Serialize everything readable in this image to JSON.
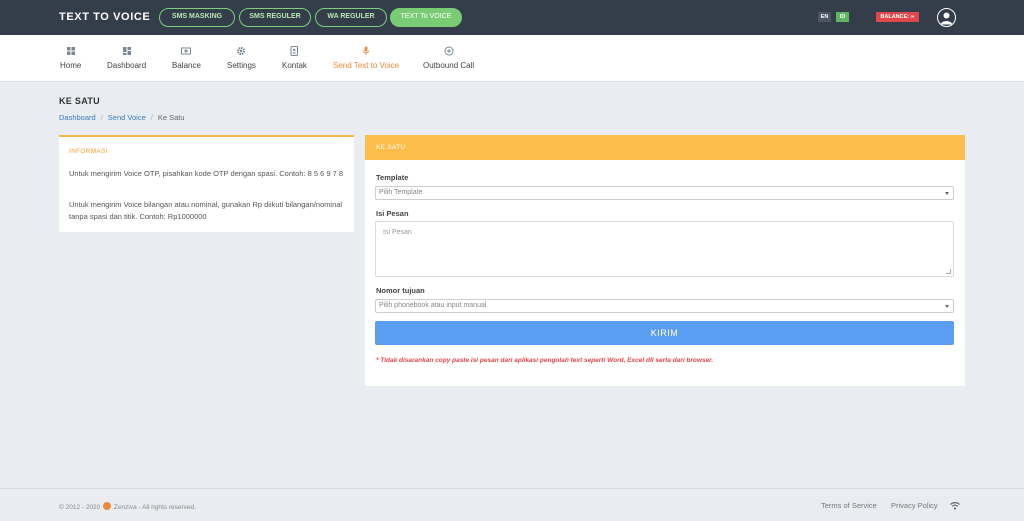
{
  "topbar": {
    "brand": "TEXT TO VOICE",
    "pills": [
      {
        "label": "SMS MASKING"
      },
      {
        "label": "SMS REGULER"
      },
      {
        "label": "WA REGULER"
      },
      {
        "label": "TEXT To VOICE"
      }
    ],
    "lang_en": "EN",
    "lang_id": "ID",
    "balance": "BALANCE: ∞"
  },
  "nav": {
    "items": [
      {
        "label": "Home",
        "icon": "grid-icon"
      },
      {
        "label": "Dashboard",
        "icon": "dashboard-icon"
      },
      {
        "label": "Balance",
        "icon": "money-icon"
      },
      {
        "label": "Settings",
        "icon": "gear-icon"
      },
      {
        "label": "Kontak",
        "icon": "contact-book-icon"
      },
      {
        "label": "Send Text to Voice",
        "icon": "microphone-icon"
      },
      {
        "label": "Outbound Call",
        "icon": "add-circle-icon"
      }
    ],
    "active_color": "#f0883a"
  },
  "page": {
    "title": "KE SATU",
    "breadcrumb": [
      "Dashboard",
      "Send Voice",
      "Ke Satu"
    ]
  },
  "info": {
    "title": "INFORMASI",
    "p1": "Untuk mengirim Voice OTP, pisahkan kode OTP dengan spasi. Contoh: 8 5 6 9 7 8",
    "p2": "Untuk mengirim Voice bilangan atau nominal, gunakan Rp diikuti bilangan/nominal tanpa spasi dan titik. Contoh: Rp1000000"
  },
  "form": {
    "header": "KE SATU",
    "template_label": "Template",
    "template_value": "Pilih Template",
    "message_label": "Isi Pesan",
    "message_placeholder": "Isi Pesan",
    "destination_label": "Nomor tujuan",
    "destination_value": "Pilih phonebook atau input manual",
    "submit_label": "KIRIM",
    "note": "* Tidak disarankan copy paste isi pesan dari aplikasi pengolah text seperti Word, Excel dll serta dari browser."
  },
  "footer": {
    "copyright_pre": "© 2012 - 2020",
    "copyright_post": "Zenziva - All rights reserved.",
    "terms": "Terms of Service",
    "privacy": "Privacy Policy"
  },
  "colors": {
    "topbar": "#343d4a",
    "accent_green": "#79cc73",
    "header_yellow": "#fcbd4a",
    "button_blue": "#5b9df0",
    "note_red": "#e2474b"
  }
}
